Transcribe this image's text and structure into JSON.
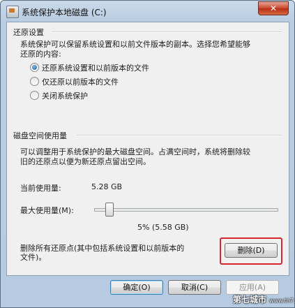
{
  "window": {
    "title": "系统保护本地磁盘 (C:)",
    "close_glyph": "✕"
  },
  "restore": {
    "group_title": "还原设置",
    "description_line1": "系统保护可以保留系统设置和以前文件版本的副本。选择您希望能够",
    "description_line2": "还原的内容:",
    "options": [
      {
        "label": "还原系统设置和以前版本的文件",
        "checked": true
      },
      {
        "label": "仅还原以前版本的文件",
        "checked": false
      },
      {
        "label": "关闭系统保护",
        "checked": false
      }
    ]
  },
  "disk": {
    "group_title": "磁盘空间使用量",
    "description_line1": "可以调整用于系统保护的最大磁盘空间。占满空间时，系统将删除较",
    "description_line2": "旧的还原点以便为新还原点留出空间。",
    "current_label": "当前使用量:",
    "current_value": "5.28 GB",
    "max_label": "最大使用量(M):",
    "max_value": "5% (5.58 GB)",
    "max_percent": 5
  },
  "delete": {
    "text_line1": "删除所有还原点(其中包括系统设置和以前版本的",
    "text_line2": "文件)。",
    "button_label": "删除(D)"
  },
  "footer": {
    "ok_label": "确定(O)",
    "cancel_label": "取消(C)",
    "apply_label": "应用(A)"
  },
  "watermark": {
    "text": "第七城市",
    "sub": "www.th7.cn"
  },
  "colors": {
    "highlight": "#d8252d",
    "accent": "#3c7fb1"
  }
}
